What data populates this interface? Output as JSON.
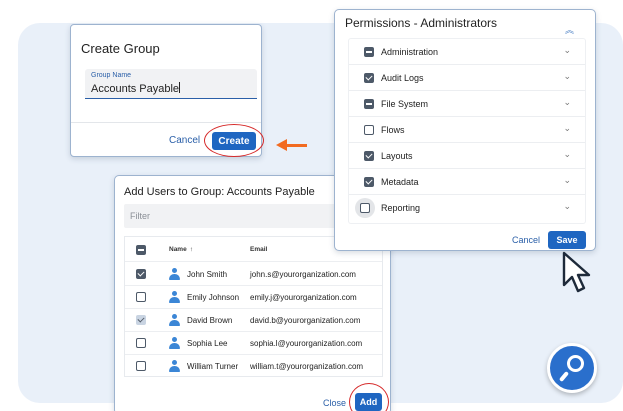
{
  "create_group": {
    "title": "Create Group",
    "field_label": "Group Name",
    "field_value": "Accounts Payable",
    "cancel_label": "Cancel",
    "create_label": "Create"
  },
  "permissions": {
    "title": "Permissions - Administrators",
    "items": [
      {
        "label": "Administration",
        "state": "partial"
      },
      {
        "label": "Audit Logs",
        "state": "checked"
      },
      {
        "label": "File System",
        "state": "partial"
      },
      {
        "label": "Flows",
        "state": "unchecked"
      },
      {
        "label": "Layouts",
        "state": "checked"
      },
      {
        "label": "Metadata",
        "state": "checked"
      },
      {
        "label": "Reporting",
        "state": "unchecked"
      }
    ],
    "cancel_label": "Cancel",
    "save_label": "Save"
  },
  "add_users": {
    "title": "Add Users to Group: Accounts Payable",
    "filter_placeholder": "Filter",
    "columns": {
      "name": "Name",
      "sort_indicator": "↑",
      "email": "Email"
    },
    "rows": [
      {
        "name": "John Smith",
        "email": "john.s@yourorganization.com",
        "checked": true
      },
      {
        "name": "Emily Johnson",
        "email": "emily.j@yourorganization.com",
        "checked": false
      },
      {
        "name": "David Brown",
        "email": "david.b@yourorganization.com",
        "checked": true
      },
      {
        "name": "Sophia Lee",
        "email": "sophia.l@yourorganization.com",
        "checked": false
      },
      {
        "name": "William Turner",
        "email": "william.t@yourorganization.com",
        "checked": false
      }
    ],
    "close_label": "Close",
    "add_label": "Add"
  },
  "icons": {
    "collapse": "double-chevron-up-icon",
    "row_expand": "chevron-down-icon",
    "user": "user-icon",
    "annotation_arrow": "arrow-left-icon",
    "pointer": "mouse-pointer-icon",
    "search": "search-icon"
  },
  "colors": {
    "primary": "#1f66c1",
    "highlight_circle": "#d62b2b",
    "arrow": "#f26b21",
    "background_panel": "#e9f0f9"
  }
}
